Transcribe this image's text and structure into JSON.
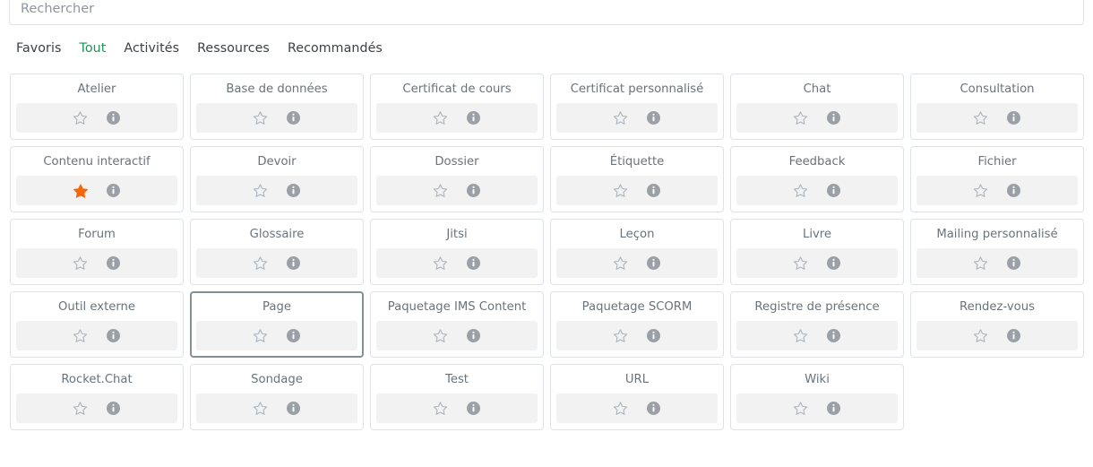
{
  "search": {
    "placeholder": "Rechercher",
    "value": ""
  },
  "tabs": [
    {
      "label": "Favoris",
      "active": false
    },
    {
      "label": "Tout",
      "active": true
    },
    {
      "label": "Activités",
      "active": false
    },
    {
      "label": "Ressources",
      "active": false
    },
    {
      "label": "Recommandés",
      "active": false
    }
  ],
  "colors": {
    "active_tab": "#1f9254",
    "favorite_star": "#f76707",
    "card_border": "#dee2e6",
    "card_border_selected": "#868e96",
    "card_footer_bg": "#f2f2f3",
    "title_text": "#6a737b",
    "icon_muted": "#adb5bd"
  },
  "icons": {
    "star_outline": "star-outline-icon",
    "star_filled": "star-filled-icon",
    "info": "info-circle-icon",
    "search": "search-icon"
  },
  "items": [
    {
      "label": "Atelier",
      "favorite": false,
      "selected": false
    },
    {
      "label": "Base de données",
      "favorite": false,
      "selected": false
    },
    {
      "label": "Certificat de cours",
      "favorite": false,
      "selected": false
    },
    {
      "label": "Certificat personnalisé",
      "favorite": false,
      "selected": false
    },
    {
      "label": "Chat",
      "favorite": false,
      "selected": false
    },
    {
      "label": "Consultation",
      "favorite": false,
      "selected": false
    },
    {
      "label": "Contenu interactif",
      "favorite": true,
      "selected": false
    },
    {
      "label": "Devoir",
      "favorite": false,
      "selected": false
    },
    {
      "label": "Dossier",
      "favorite": false,
      "selected": false
    },
    {
      "label": "Étiquette",
      "favorite": false,
      "selected": false
    },
    {
      "label": "Feedback",
      "favorite": false,
      "selected": false
    },
    {
      "label": "Fichier",
      "favorite": false,
      "selected": false
    },
    {
      "label": "Forum",
      "favorite": false,
      "selected": false
    },
    {
      "label": "Glossaire",
      "favorite": false,
      "selected": false
    },
    {
      "label": "Jitsi",
      "favorite": false,
      "selected": false
    },
    {
      "label": "Leçon",
      "favorite": false,
      "selected": false
    },
    {
      "label": "Livre",
      "favorite": false,
      "selected": false
    },
    {
      "label": "Mailing personnalisé",
      "favorite": false,
      "selected": false
    },
    {
      "label": "Outil externe",
      "favorite": false,
      "selected": false
    },
    {
      "label": "Page",
      "favorite": false,
      "selected": true
    },
    {
      "label": "Paquetage IMS Content",
      "favorite": false,
      "selected": false
    },
    {
      "label": "Paquetage SCORM",
      "favorite": false,
      "selected": false
    },
    {
      "label": "Registre de présence",
      "favorite": false,
      "selected": false
    },
    {
      "label": "Rendez-vous",
      "favorite": false,
      "selected": false
    },
    {
      "label": "Rocket.Chat",
      "favorite": false,
      "selected": false
    },
    {
      "label": "Sondage",
      "favorite": false,
      "selected": false
    },
    {
      "label": "Test",
      "favorite": false,
      "selected": false
    },
    {
      "label": "URL",
      "favorite": false,
      "selected": false
    },
    {
      "label": "Wiki",
      "favorite": false,
      "selected": false
    }
  ]
}
